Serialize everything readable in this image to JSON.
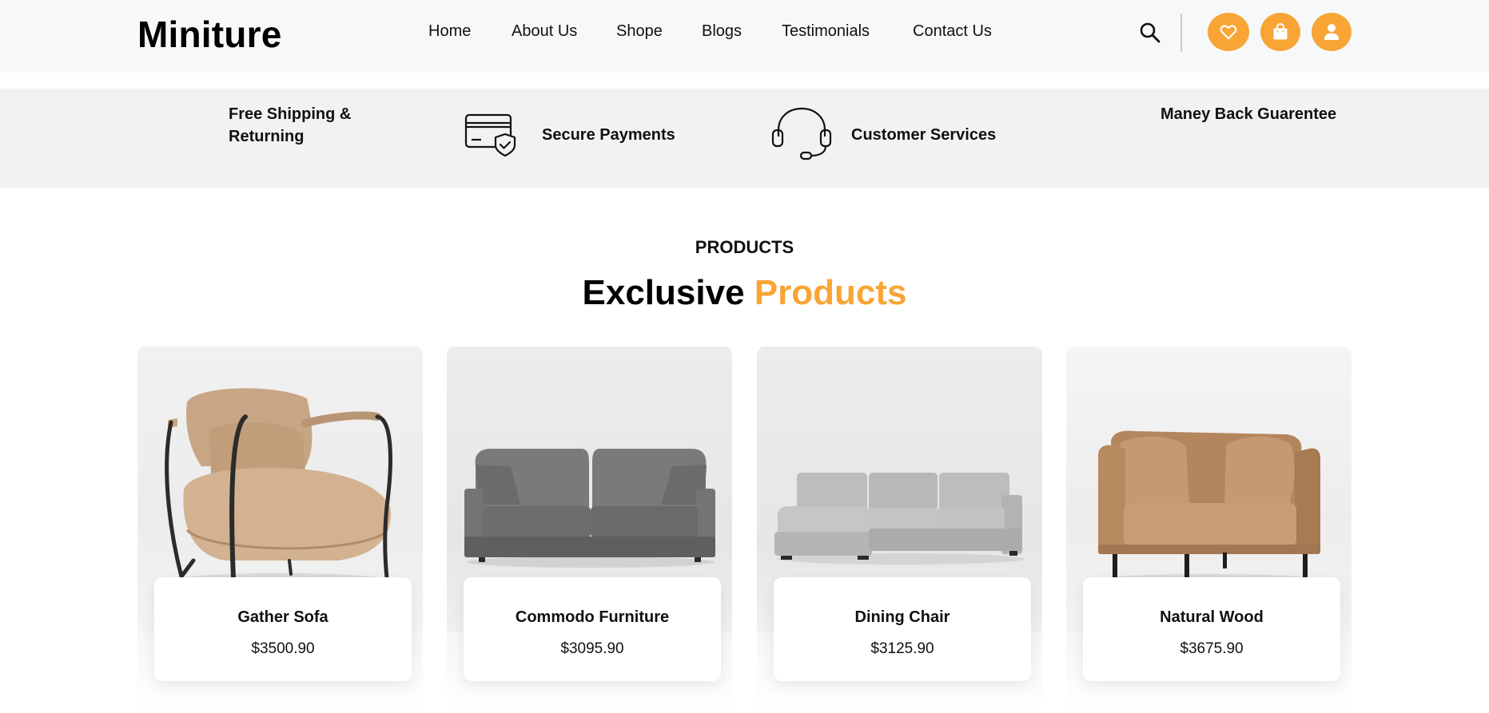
{
  "header": {
    "logo": "Miniture",
    "nav": [
      "Home",
      "About Us",
      "Shope",
      "Blogs",
      "Testimonials",
      "Contact Us"
    ],
    "accent_color": "#f8a535",
    "icons": [
      "search-icon",
      "heart-icon",
      "shopping-bag-icon",
      "user-icon"
    ]
  },
  "features": [
    {
      "label": "Free Shipping & Returning",
      "icon": ""
    },
    {
      "label": "Secure Payments",
      "icon": "credit-card-shield-icon"
    },
    {
      "label": "Customer Services",
      "icon": "headset-icon"
    },
    {
      "label": "Maney Back Guarentee",
      "icon": ""
    }
  ],
  "products_section": {
    "eyebrow": "PRODUCTS",
    "title_main": "Exclusive",
    "title_accent": "Products",
    "items": [
      {
        "name": "Gather Sofa",
        "price": "$3500.90"
      },
      {
        "name": "Commodo Furniture",
        "price": "$3095.90"
      },
      {
        "name": "Dining Chair",
        "price": "$3125.90"
      },
      {
        "name": "Natural Wood",
        "price": "$3675.90"
      }
    ]
  }
}
